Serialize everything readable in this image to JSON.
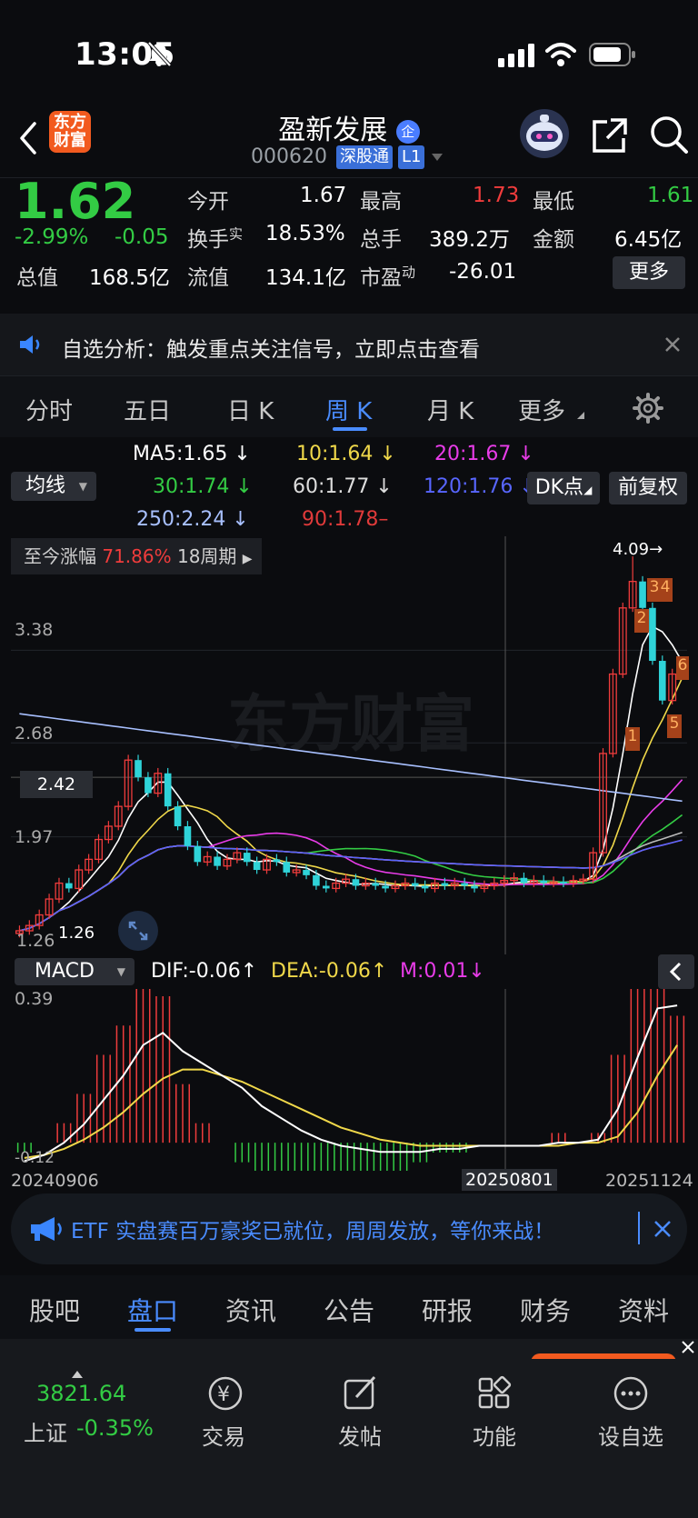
{
  "status_bar": {
    "time": "13:05"
  },
  "header": {
    "brand_line1": "东方",
    "brand_line2": "财富",
    "stock_name": "盈新发展",
    "enterprise_badge": "企",
    "stock_code": "000620",
    "tag_connect": "深股通",
    "tag_level": "L1"
  },
  "quote": {
    "price": "1.62",
    "change_pct": "-2.99%",
    "change_amt": "-0.05",
    "open_label": "今开",
    "open_value": "1.67",
    "high_label": "最高",
    "high_value": "1.73",
    "low_label": "最低",
    "low_value": "1.61",
    "turnover_label": "换手",
    "turnover_sup": "实",
    "turnover_value": "18.53%",
    "volume_label": "总手",
    "volume_value": "389.2万",
    "amount_label": "金额",
    "amount_value": "6.45亿",
    "mktcap_label": "总值",
    "mktcap_value": "168.5亿",
    "float_label": "流值",
    "float_value": "134.1亿",
    "pe_label": "市盈",
    "pe_sup": "动",
    "pe_value": "-26.01",
    "more_button": "更多"
  },
  "notice": {
    "text": "自选分析：触发重点关注信号，立即点击查看"
  },
  "chart_tabs": [
    "分时",
    "五日",
    "日 K",
    "周 K",
    "月 K",
    "更多"
  ],
  "chart_tabs_active": "周 K",
  "ma_legend": {
    "indicator_select": "均线",
    "ma5": "MA5:1.65",
    "ma10": "10:1.64",
    "ma20": "20:1.67",
    "ma30": "30:1.74",
    "ma60": "60:1.77",
    "ma120": "120:1.76",
    "ma250": "250:2.24",
    "ma90": "90:1.78",
    "dk_button": "DK点",
    "adjust_button": "前复权"
  },
  "kline": {
    "range_label": "至今涨幅",
    "range_value": "71.86%",
    "range_period": "18周期",
    "price_ticks": [
      "3.38",
      "2.68",
      "1.97",
      "1.26"
    ],
    "crosshair_price": "2.42",
    "high_marker": "4.09",
    "low_marker": "1.26",
    "watermark": "东方财富",
    "signal_labels": [
      "1",
      "2",
      "3",
      "4",
      "5",
      "6"
    ]
  },
  "macd": {
    "indicator_select": "MACD",
    "dif": "DIF:-0.06",
    "dea": "DEA:-0.06",
    "m": "M:0.01",
    "top_tick": "0.39",
    "bottom_tick": "-0.12"
  },
  "dates": {
    "start": "20240906",
    "cursor": "20250801",
    "end": "20251124"
  },
  "ad_banner": {
    "text": "ETF 实盘赛百万豪奖已就位，周周发放，等你来战！"
  },
  "bottom_tabs": [
    "股吧",
    "盘口",
    "资讯",
    "公告",
    "研报",
    "财务",
    "资料"
  ],
  "bottom_tabs_active": "盘口",
  "dock": {
    "index_value": "3821.64",
    "index_name": "上证",
    "index_change": "-0.35%",
    "items": [
      "交易",
      "发帖",
      "功能",
      "设自选"
    ]
  },
  "colors": {
    "up": "#f03c3c",
    "down": "#2fd3d8",
    "green": "#33cc44",
    "accent_blue": "#4a8cff",
    "brand_orange": "#f25a1f"
  },
  "chart_data": {
    "type": "candlestick",
    "title": "",
    "xlabel": "",
    "ylabel": "",
    "ylim": [
      1.26,
      4.09
    ],
    "x_start": "20240906",
    "x_end": "20251124",
    "close": [
      1.26,
      1.3,
      1.38,
      1.5,
      1.62,
      1.58,
      1.72,
      1.8,
      1.95,
      2.05,
      2.2,
      2.55,
      2.42,
      2.3,
      2.45,
      2.2,
      2.05,
      1.9,
      1.78,
      1.82,
      1.75,
      1.8,
      1.85,
      1.78,
      1.72,
      1.8,
      1.78,
      1.7,
      1.72,
      1.68,
      1.6,
      1.58,
      1.62,
      1.65,
      1.6,
      1.62,
      1.6,
      1.58,
      1.6,
      1.62,
      1.6,
      1.58,
      1.62,
      1.6,
      1.62,
      1.6,
      1.58,
      1.6,
      1.62,
      1.64,
      1.66,
      1.62,
      1.64,
      1.62,
      1.63,
      1.62,
      1.64,
      1.65,
      1.85,
      2.6,
      3.2,
      3.7,
      3.9,
      3.7,
      3.3,
      3.0,
      3.2,
      3.26
    ],
    "macd_dif": [
      -0.12,
      -0.1,
      -0.06,
      0.0,
      0.08,
      0.16,
      0.26,
      0.3,
      0.24,
      0.2,
      0.16,
      0.12,
      0.06,
      0.02,
      -0.02,
      -0.05,
      -0.07,
      -0.08,
      -0.09,
      -0.09,
      -0.09,
      -0.08,
      -0.08,
      -0.07,
      -0.07,
      -0.07,
      -0.07,
      -0.06,
      -0.06,
      -0.05,
      0.05,
      0.22,
      0.38,
      0.39
    ],
    "macd_dea": [
      -0.11,
      -0.1,
      -0.08,
      -0.05,
      -0.01,
      0.04,
      0.1,
      0.15,
      0.18,
      0.18,
      0.16,
      0.14,
      0.11,
      0.08,
      0.05,
      0.02,
      -0.01,
      -0.03,
      -0.05,
      -0.06,
      -0.07,
      -0.07,
      -0.07,
      -0.07,
      -0.07,
      -0.07,
      -0.07,
      -0.07,
      -0.06,
      -0.06,
      -0.04,
      0.04,
      0.16,
      0.26
    ]
  }
}
